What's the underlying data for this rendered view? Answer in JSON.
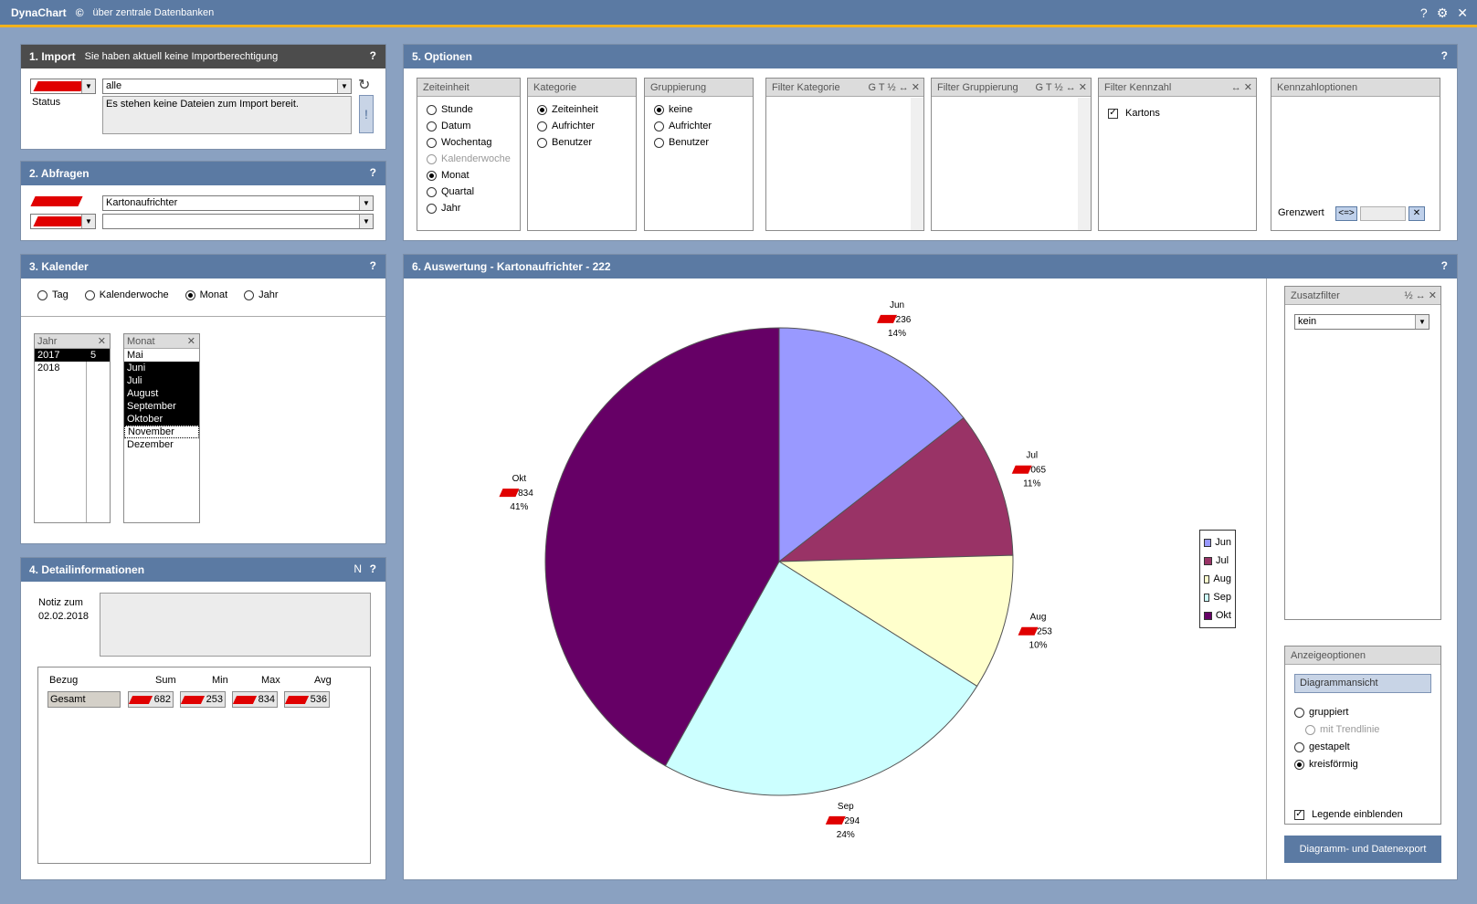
{
  "title": {
    "app": "DynaChart",
    "copyright": "©",
    "subtitle": "über zentrale Datenbanken",
    "help": "?",
    "settings": "⚙",
    "close": "✕"
  },
  "import": {
    "title": "1. Import",
    "notice": "Sie haben aktuell keine Importberechtigung",
    "help": "?",
    "select_value": "alle",
    "status_label": "Status",
    "status_text": "Es stehen keine Dateien zum Import bereit.",
    "refresh": "↻",
    "alert": "!"
  },
  "abfragen": {
    "title": "2. Abfragen",
    "help": "?",
    "select1_value": "Kartonaufrichter",
    "select2_value": ""
  },
  "kalender": {
    "title": "3. Kalender",
    "help": "?",
    "options": [
      {
        "label": "Tag",
        "selected": false
      },
      {
        "label": "Kalenderwoche",
        "selected": false
      },
      {
        "label": "Monat",
        "selected": true
      },
      {
        "label": "Jahr",
        "selected": false
      }
    ],
    "jahr_header": "Jahr",
    "jahr_rows": [
      {
        "label": "2017",
        "count": "5",
        "selected": true
      },
      {
        "label": "2018",
        "count": "",
        "selected": false
      }
    ],
    "monat_header": "Monat",
    "monat_rows": [
      {
        "label": "Mai",
        "selected": false
      },
      {
        "label": "Juni",
        "selected": true
      },
      {
        "label": "Juli",
        "selected": true
      },
      {
        "label": "August",
        "selected": true
      },
      {
        "label": "September",
        "selected": true
      },
      {
        "label": "Oktober",
        "selected": true
      },
      {
        "label": "November",
        "selected": false
      },
      {
        "label": "Dezember",
        "selected": false
      }
    ],
    "close": "✕"
  },
  "details": {
    "title": "4. Detailinformationen",
    "n_button": "N",
    "help": "?",
    "note_label": "Notiz zum",
    "note_date": "02.02.2018",
    "cols": [
      "Bezug",
      "Sum",
      "Min",
      "Max",
      "Avg"
    ],
    "row_label": "Gesamt",
    "values": [
      "682",
      "253",
      "834",
      "536"
    ]
  },
  "optionen": {
    "title": "5. Optionen",
    "help": "?",
    "zeiteinheit": {
      "header": "Zeiteinheit",
      "items": [
        {
          "label": "Stunde",
          "selected": false,
          "disabled": false
        },
        {
          "label": "Datum",
          "selected": false,
          "disabled": false
        },
        {
          "label": "Wochentag",
          "selected": false,
          "disabled": false
        },
        {
          "label": "Kalenderwoche",
          "selected": false,
          "disabled": true
        },
        {
          "label": "Monat",
          "selected": true,
          "disabled": false
        },
        {
          "label": "Quartal",
          "selected": false,
          "disabled": false
        },
        {
          "label": "Jahr",
          "selected": false,
          "disabled": false
        }
      ]
    },
    "kategorie": {
      "header": "Kategorie",
      "items": [
        {
          "label": "Zeiteinheit",
          "selected": true
        },
        {
          "label": "Aufrichter",
          "selected": false
        },
        {
          "label": "Benutzer",
          "selected": false
        }
      ]
    },
    "gruppierung": {
      "header": "Gruppierung",
      "items": [
        {
          "label": "keine",
          "selected": true
        },
        {
          "label": "Aufrichter",
          "selected": false
        },
        {
          "label": "Benutzer",
          "selected": false
        }
      ]
    },
    "filter_kategorie": {
      "header": "Filter Kategorie",
      "tools": "G  T  ½  ↔ ✕"
    },
    "filter_gruppierung": {
      "header": "Filter Gruppierung",
      "tools": "G  T  ½  ↔ ✕"
    },
    "filter_kennzahl": {
      "header": "Filter Kennzahl",
      "tools": "↔ ✕",
      "item": "Kartons",
      "checked": "✓"
    },
    "kennzahloptionen": {
      "header": "Kennzahloptionen",
      "grenzwert_label": "Grenzwert",
      "compare_btn": "<=>",
      "clear_btn": "✕"
    }
  },
  "auswertung": {
    "title": "6. Auswertung - Kartonaufrichter - 222",
    "help": "?"
  },
  "zusatzfilter": {
    "header": "Zusatzfilter",
    "tools": "½  ↔ ✕",
    "select_value": "kein"
  },
  "anzeige": {
    "header": "Anzeigeoptionen",
    "view_btn": "Diagrammansicht",
    "options": [
      {
        "label": "gruppiert",
        "selected": false,
        "disabled": false
      },
      {
        "label": "mit Trendlinie",
        "selected": false,
        "disabled": true
      },
      {
        "label": "gestapelt",
        "selected": false,
        "disabled": false
      },
      {
        "label": "kreisförmig",
        "selected": true,
        "disabled": false
      }
    ],
    "legend_label": "Legende einblenden",
    "legend_checked": "✓",
    "export_btn": "Diagramm- und Datenexport"
  },
  "chart_data": {
    "type": "pie",
    "categories": [
      "Jun",
      "Jul",
      "Aug",
      "Sep",
      "Okt"
    ],
    "values": [
      236,
      165,
      153,
      394,
      684
    ],
    "labels": [
      "236",
      "065",
      "253",
      "294",
      "834"
    ],
    "percent_labels": [
      "14%",
      "11%",
      "10%",
      "24%",
      "41%"
    ],
    "colors": [
      "#9999ff",
      "#993366",
      "#ffffcc",
      "#ccffff",
      "#660066"
    ],
    "legend_position": "right"
  }
}
